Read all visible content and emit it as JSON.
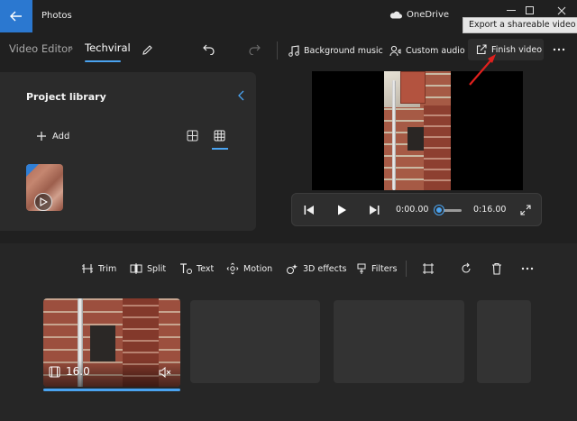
{
  "app": {
    "title": "Photos"
  },
  "titlebar": {
    "onedrive_label": "OneDrive"
  },
  "tooltip": {
    "text": "Export a shareable video file"
  },
  "breadcrumb": {
    "root": "Video Editor",
    "separator": "›",
    "current": "Techviral"
  },
  "toolbar": {
    "background_music": "Background music",
    "custom_audio": "Custom audio",
    "finish_video": "Finish video"
  },
  "library": {
    "title": "Project library",
    "add_label": "Add"
  },
  "player": {
    "current_time": "0:00.00",
    "total_time": "0:16.00",
    "progress": 0.0
  },
  "storyboard": {
    "tools": {
      "trim": "Trim",
      "split": "Split",
      "text": "Text",
      "motion": "Motion",
      "effects_3d": "3D effects",
      "filters": "Filters"
    },
    "clips": [
      {
        "duration": "16.0",
        "muted": true
      }
    ]
  },
  "colors": {
    "accent": "#4aa3f0",
    "back_button": "#2b78d0",
    "background": "#202020",
    "panel": "#2b2b2b",
    "annotation_arrow": "#e0201d"
  }
}
